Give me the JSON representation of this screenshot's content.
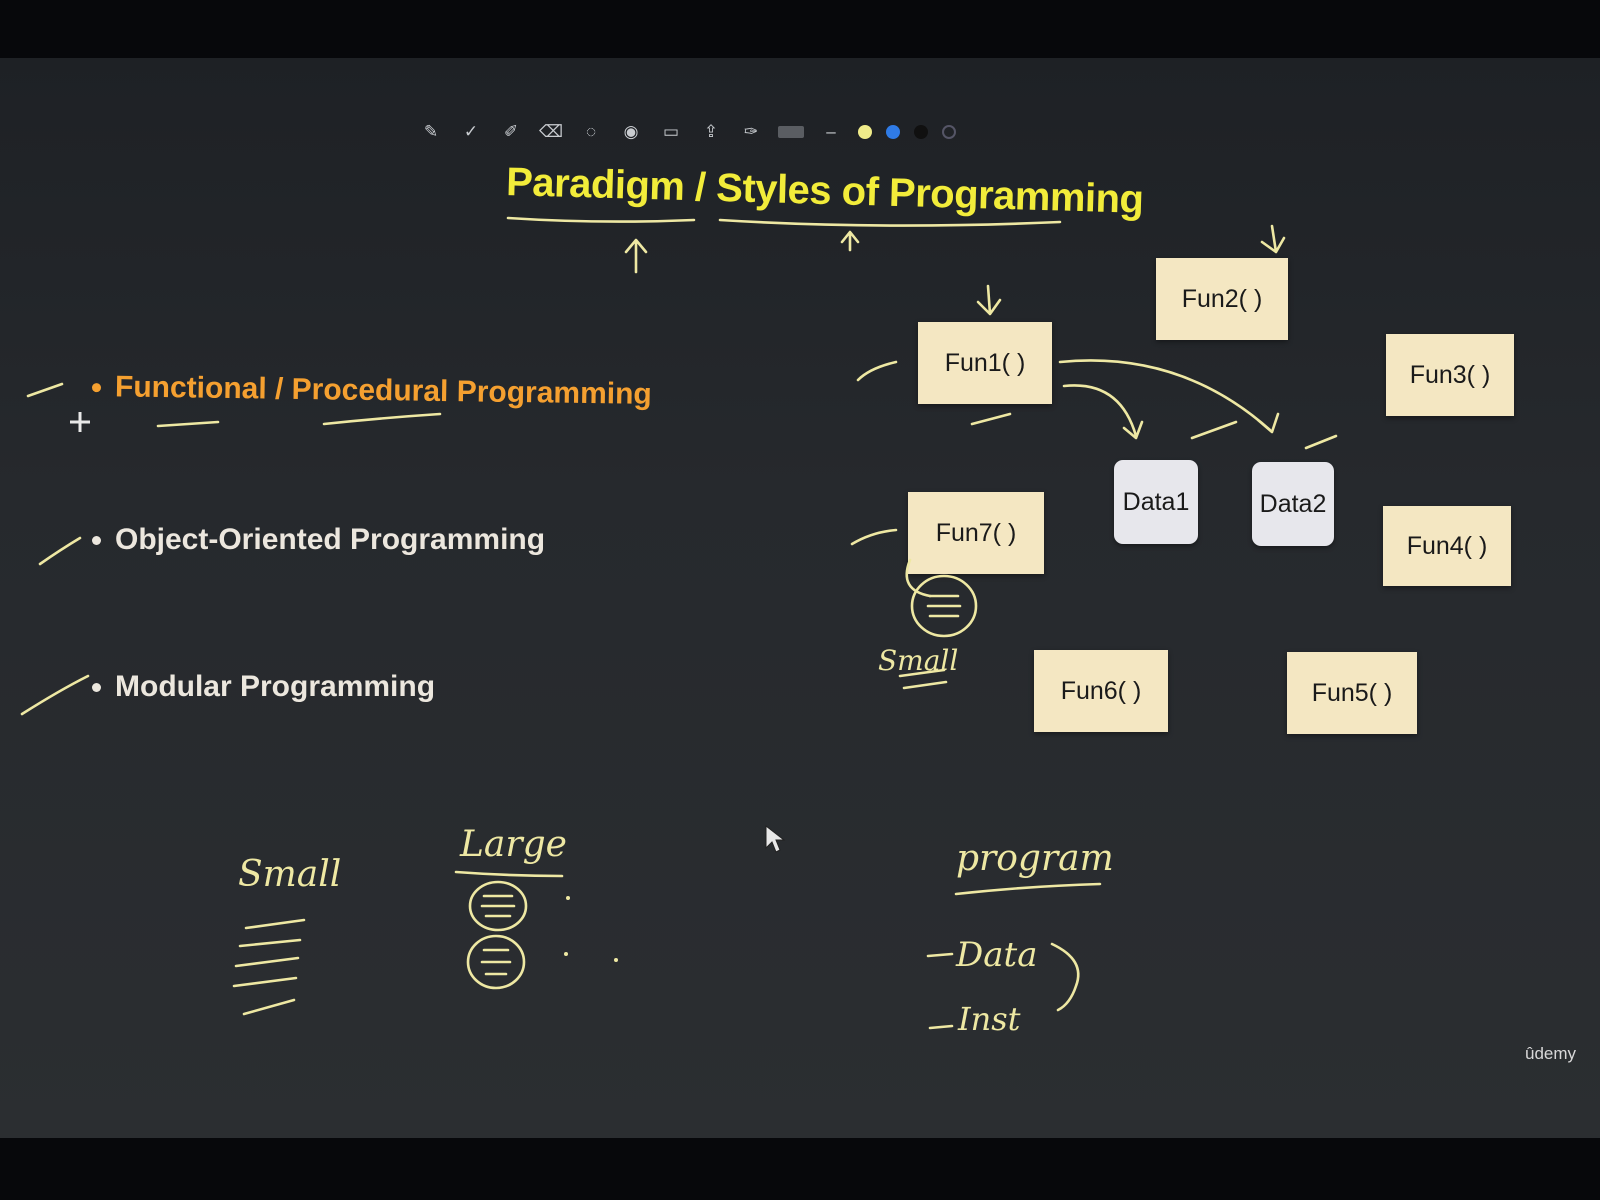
{
  "slide": {
    "title": "Paradigm / Styles of Programming",
    "bullets": [
      "Functional / Procedural Programming",
      "Object-Oriented Programming",
      "Modular Programming"
    ]
  },
  "diagram": {
    "functions": [
      "Fun1( )",
      "Fun2( )",
      "Fun3( )",
      "Fun4( )",
      "Fun5( )",
      "Fun6( )",
      "Fun7( )"
    ],
    "data": [
      "Data1",
      "Data2"
    ]
  },
  "annotations": {
    "small_near_diagram": "Small",
    "small_bottom": "Small",
    "large": "Large",
    "program": "program",
    "data_item": "Data",
    "inst_item": "Inst"
  },
  "watermark": "ûdemy",
  "colors": {
    "title": "#f2ec3a",
    "highlight_bullet": "#f5a030",
    "ink": "#eee8a3",
    "function_box": "#f4e7c2",
    "data_box": "#e7e7ec"
  },
  "toolbar_icons": [
    "pencil-icon",
    "check-pen-icon",
    "marker-icon",
    "eraser-icon",
    "lasso-icon",
    "shape-icon",
    "image-icon",
    "export-icon",
    "settings-pen-icon",
    "color-swatch-gray",
    "color-dot-yellow",
    "color-dot-blue",
    "color-dot-black",
    "color-dot-outline"
  ]
}
